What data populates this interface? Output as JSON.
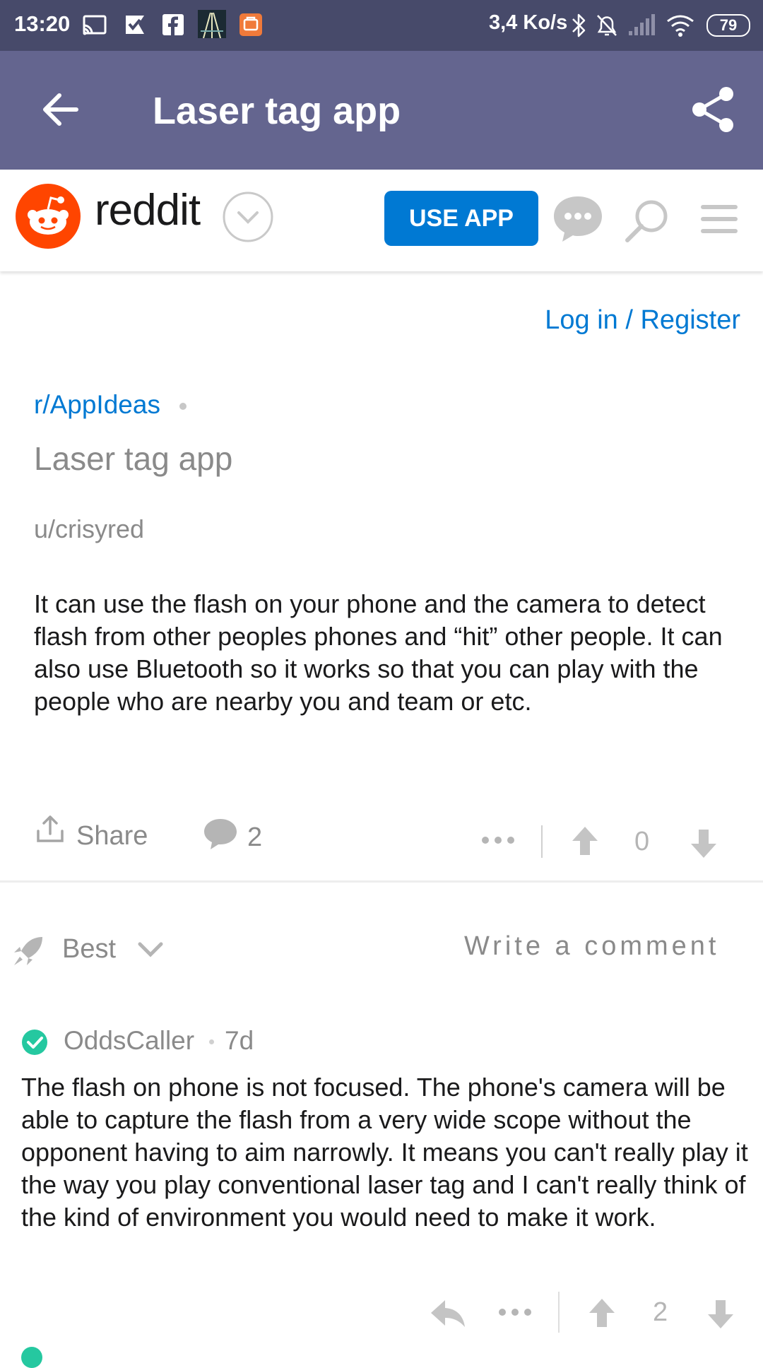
{
  "status_bar": {
    "time": "13:20",
    "net_speed": "3,4 Ko/s",
    "battery": "79"
  },
  "app_bar": {
    "title": "Laser tag app"
  },
  "reddit_header": {
    "wordmark": "reddit",
    "use_app_label": "USE APP"
  },
  "auth": {
    "login_label": "Log in / Register"
  },
  "post": {
    "subreddit": "r/AppIdeas",
    "title": "Laser tag app",
    "author": "u/crisyred",
    "body": "It can use the flash on your phone and the camera to detect flash from other peoples phones and “hit” other people. It can also use Bluetooth so it works so that you can play with the people who are nearby you and team or etc.",
    "share_label": "Share",
    "comment_count": "2",
    "score": "0"
  },
  "comments_bar": {
    "sort_label": "Best",
    "write_label": "Write a comment"
  },
  "comment": {
    "username": "OddsCaller",
    "age": "7d",
    "body": "The flash on phone is not focused. The phone's camera will be able to capture the flash from a very wide scope without the opponent having to aim narrowly. It means you can't really play it the way you play conventional laser tag and I can't really think of the kind of environment you would need to make it work.",
    "score": "2"
  },
  "colors": {
    "status_bar": "#474a6a",
    "app_bar": "#64658f",
    "reddit_orange": "#ff4500",
    "link_blue": "#0079d3",
    "verified_teal": "#25c8a0"
  }
}
